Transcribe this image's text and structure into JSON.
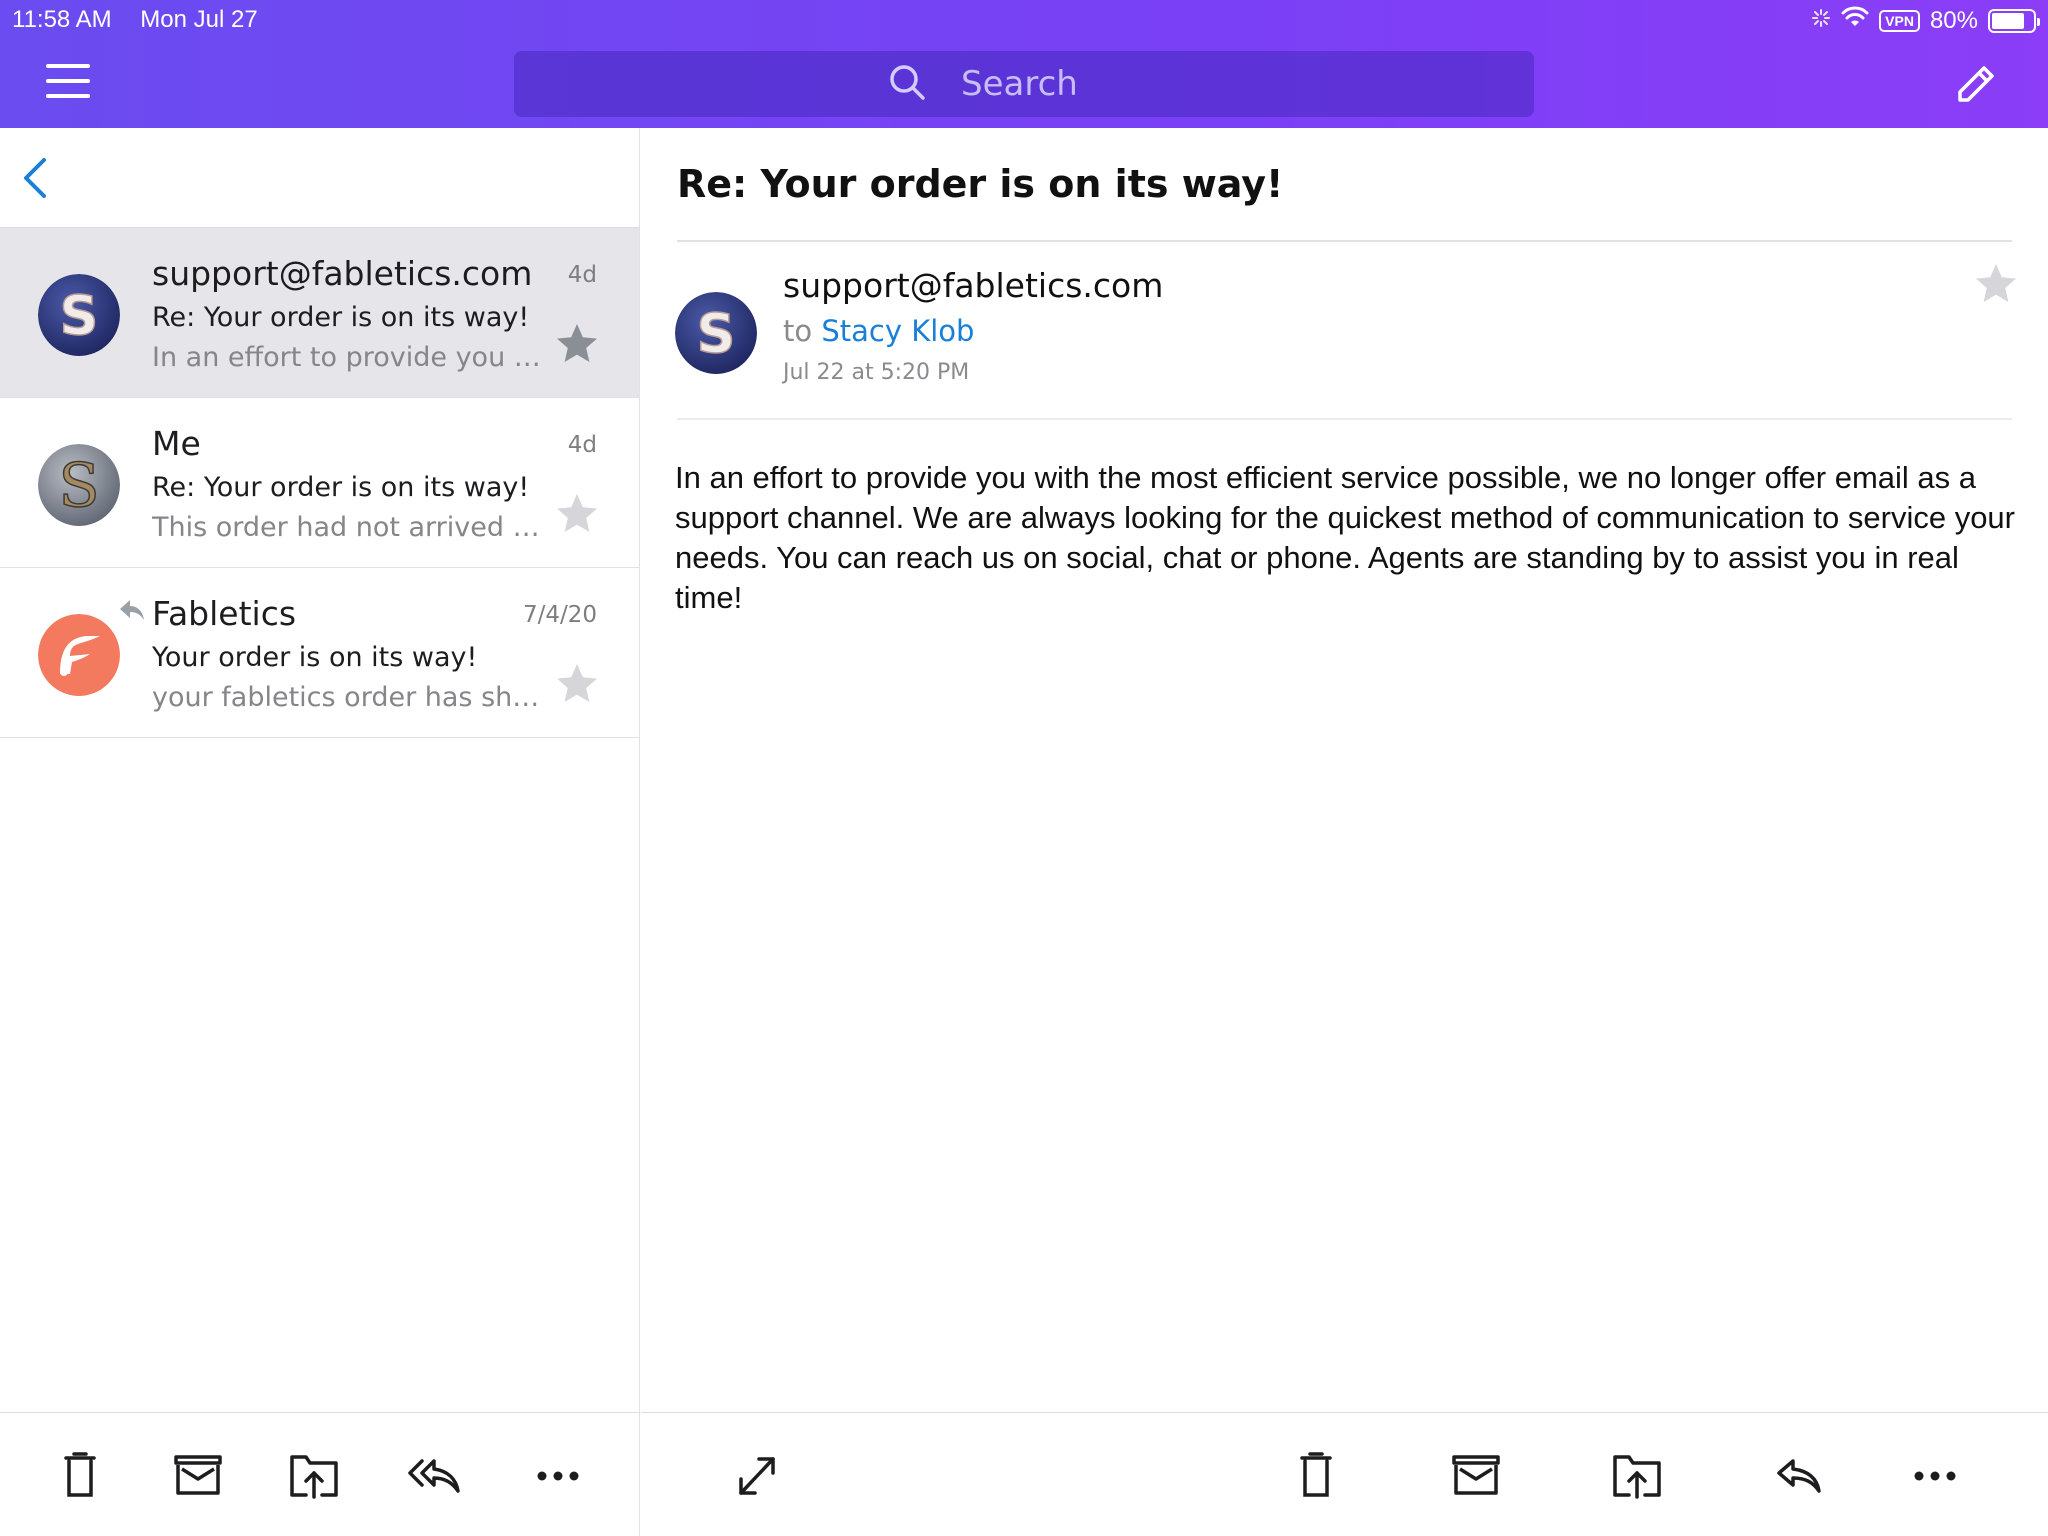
{
  "status_bar": {
    "time": "11:58 AM",
    "date": "Mon Jul 27",
    "vpn": "VPN",
    "battery": "80%",
    "battery_level": 0.8
  },
  "header": {
    "search_placeholder": "Search",
    "icons": [
      "menu-icon",
      "search-icon",
      "compose-icon"
    ]
  },
  "message_list": [
    {
      "sender": "support@fabletics.com",
      "date": "4d",
      "subject": "Re: Your order is on its way!",
      "preview": "In an effort to provide you w...",
      "starred": true,
      "selected": true,
      "replied": false
    },
    {
      "sender": "Me",
      "date": "4d",
      "subject": "Re: Your order is on its way!",
      "preview": "This order had not arrived n...",
      "starred": false,
      "selected": false,
      "replied": false
    },
    {
      "sender": "Fabletics",
      "date": "7/4/20",
      "subject": "Your order is on its way!",
      "preview": "your fabletics order has ship...",
      "starred": false,
      "selected": false,
      "replied": true
    }
  ],
  "detail": {
    "subject": "Re: Your order is on its way!",
    "from": "support@fabletics.com",
    "to_prefix": "to",
    "to": "Stacy Klob",
    "date": "Jul 22 at 5:20 PM",
    "body": "In an effort to provide you with the most efficient service possible, we no longer offer email as a support channel. We are always looking for the quickest method of communication to service your needs. You can reach us on social, chat or phone. Agents are standing by to assist you in real time!",
    "starred": false
  },
  "toolbar_left": [
    "trash-icon",
    "archive-icon",
    "move-icon",
    "reply-all-icon",
    "more-icon"
  ],
  "toolbar_right": [
    "expand-icon",
    "trash-icon",
    "archive-icon",
    "move-icon",
    "reply-icon",
    "more-icon"
  ],
  "colors": {
    "header_start": "#6a4cf0",
    "header_end": "#8b3df7",
    "link_blue": "#1a7fd6",
    "star_active": "#8a8f96",
    "star_inactive": "#d5d5da"
  }
}
